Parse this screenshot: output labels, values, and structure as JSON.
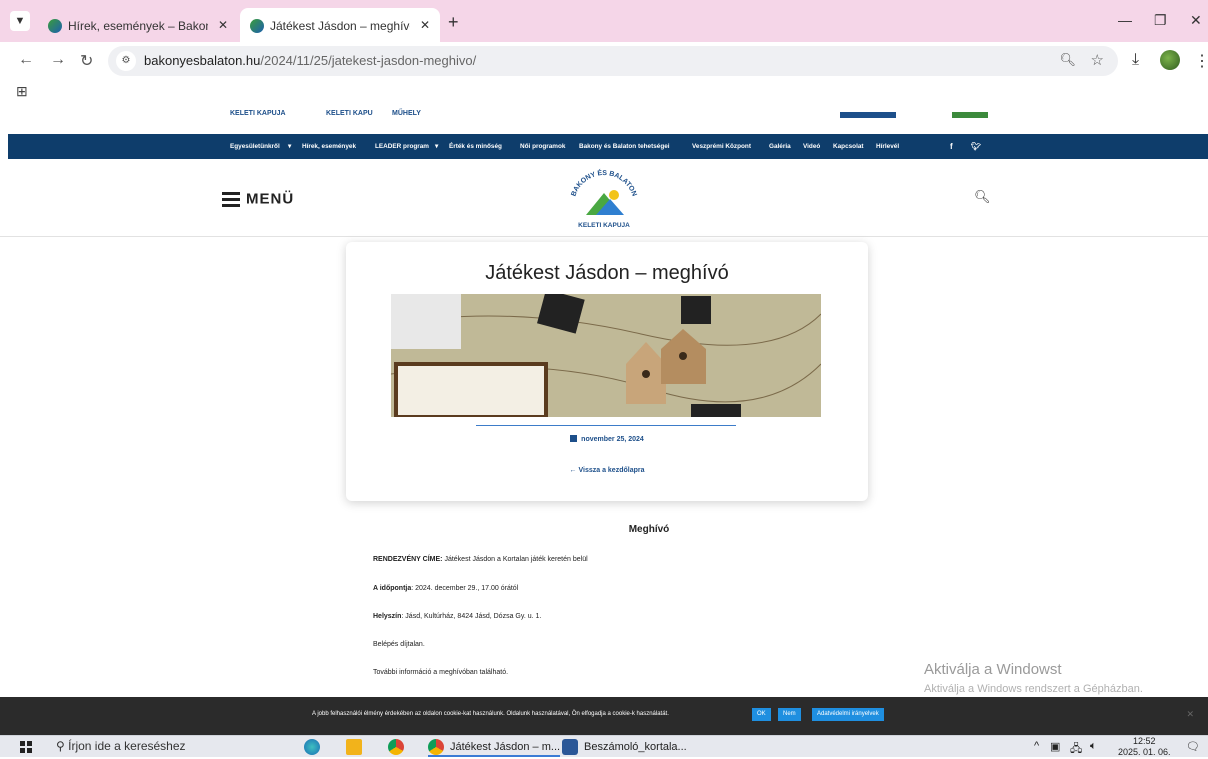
{
  "browser": {
    "tabs": [
      {
        "title": "Hírek, események – Bakony és E"
      },
      {
        "title": "Játékest Jásdon – meghívó – Ba"
      }
    ],
    "new_tab": "+",
    "url_host": "bakonyesbalaton.hu",
    "url_path": "/2024/11/25/jatekest-jasdon-meghivo/"
  },
  "site": {
    "logo_strip": {
      "texts": [
        "KELETI KAPUJA",
        "KELETI KAPU",
        "MŰHELY"
      ]
    },
    "nav": [
      "Egyesületünkről",
      "Hírek, események",
      "LEADER program",
      "Érték és minőség",
      "Női programok",
      "Bakony és Balaton tehetségei",
      "Veszprémi Központ",
      "Galéria",
      "Videó",
      "Kapcsolat",
      "Hírlevél"
    ],
    "menu_label": "MENÜ",
    "logo_top": "BAKONY ÉS BALATON",
    "logo_bottom": "KELETI KAPUJA"
  },
  "post": {
    "title": "Játékest Jásdon – meghívó",
    "date": "november 25, 2024",
    "back": "← Vissza a kezdőlapra"
  },
  "content": {
    "heading": "Meghívó",
    "paragraphs": [
      {
        "label": "RENDEZVÉNY CÍME:",
        "text": " Játékest Jásdon a Kortalan játék keretén belül"
      },
      {
        "label": "A időpontja",
        "text": ": 2024. december 29., 17.00 órától"
      },
      {
        "label": "Helyszín",
        "text": ": Jásd, Kultúrház, 8424 Jásd, Dózsa Gy. u. 1."
      },
      {
        "label": "",
        "text": "Belépés díjtalan."
      },
      {
        "label": "",
        "text": "További információ a meghívóban található."
      }
    ]
  },
  "watermark": {
    "title": "Aktiválja a Windowst",
    "subtitle": "Aktiválja a Windows rendszert a Gépházban."
  },
  "cookie": {
    "message": "A jobb felhasználói élmény érdekében az oldalon cookie-kat használunk. Oldalunk használatával, Ön elfogadja a cookie-k használatát.",
    "ok": "OK",
    "no": "Nem",
    "policy": "Adatvédelmi irányelvek"
  },
  "taskbar": {
    "search_placeholder": "Írjon ide a kereséshez",
    "tasks": [
      "Játékest Jásdon – m...",
      "Beszámoló_kortala..."
    ],
    "time": "12:52",
    "date": "2025. 01. 06."
  },
  "colors": {
    "nav_bg": "#0e3d6b",
    "accent": "#1d4f8a",
    "cookie_button": "#1f8fe0",
    "tab_strip": "#f5d6e8"
  }
}
